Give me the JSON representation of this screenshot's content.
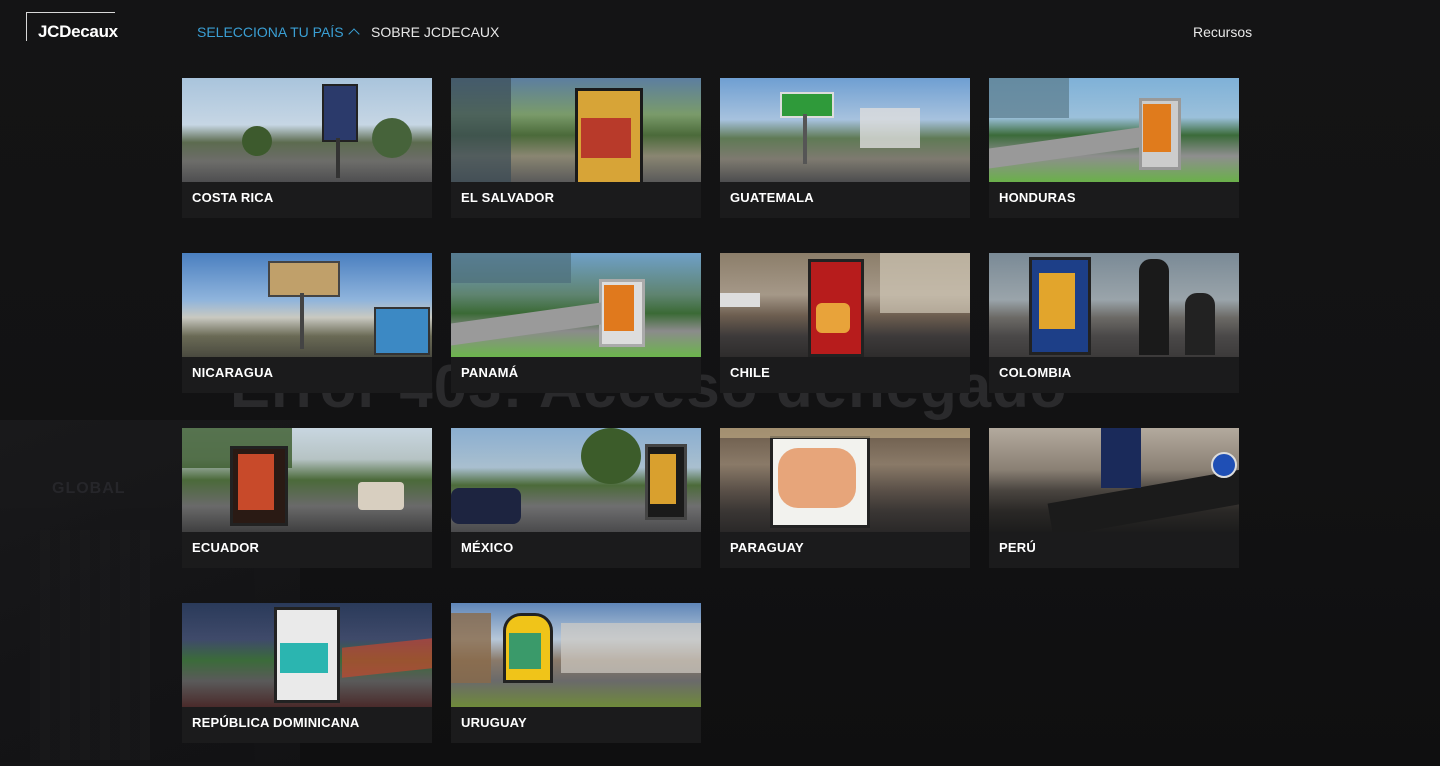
{
  "brand": {
    "logo_text": "JCDecaux"
  },
  "nav": {
    "country_label": "SELECCIONA TU PAÍS",
    "about_label": "SOBRE JCDECAUX",
    "resources_label": "Recursos"
  },
  "background": {
    "error_title": "Error 403: Acceso denegado",
    "global_text": "GLOBAL"
  },
  "colors": {
    "accent": "#3a9fd4",
    "card_bg": "#1b1b1c",
    "page_bg": "#111112"
  },
  "countries": [
    {
      "name": "COSTA RICA"
    },
    {
      "name": "EL SALVADOR"
    },
    {
      "name": "GUATEMALA"
    },
    {
      "name": "HONDURAS"
    },
    {
      "name": "NICARAGUA"
    },
    {
      "name": "PANAMÁ"
    },
    {
      "name": "CHILE"
    },
    {
      "name": "COLOMBIA"
    },
    {
      "name": "ECUADOR"
    },
    {
      "name": "MÉXICO"
    },
    {
      "name": "PARAGUAY"
    },
    {
      "name": "PERÚ"
    },
    {
      "name": "REPÚBLICA DOMINICANA"
    },
    {
      "name": "URUGUAY"
    }
  ]
}
